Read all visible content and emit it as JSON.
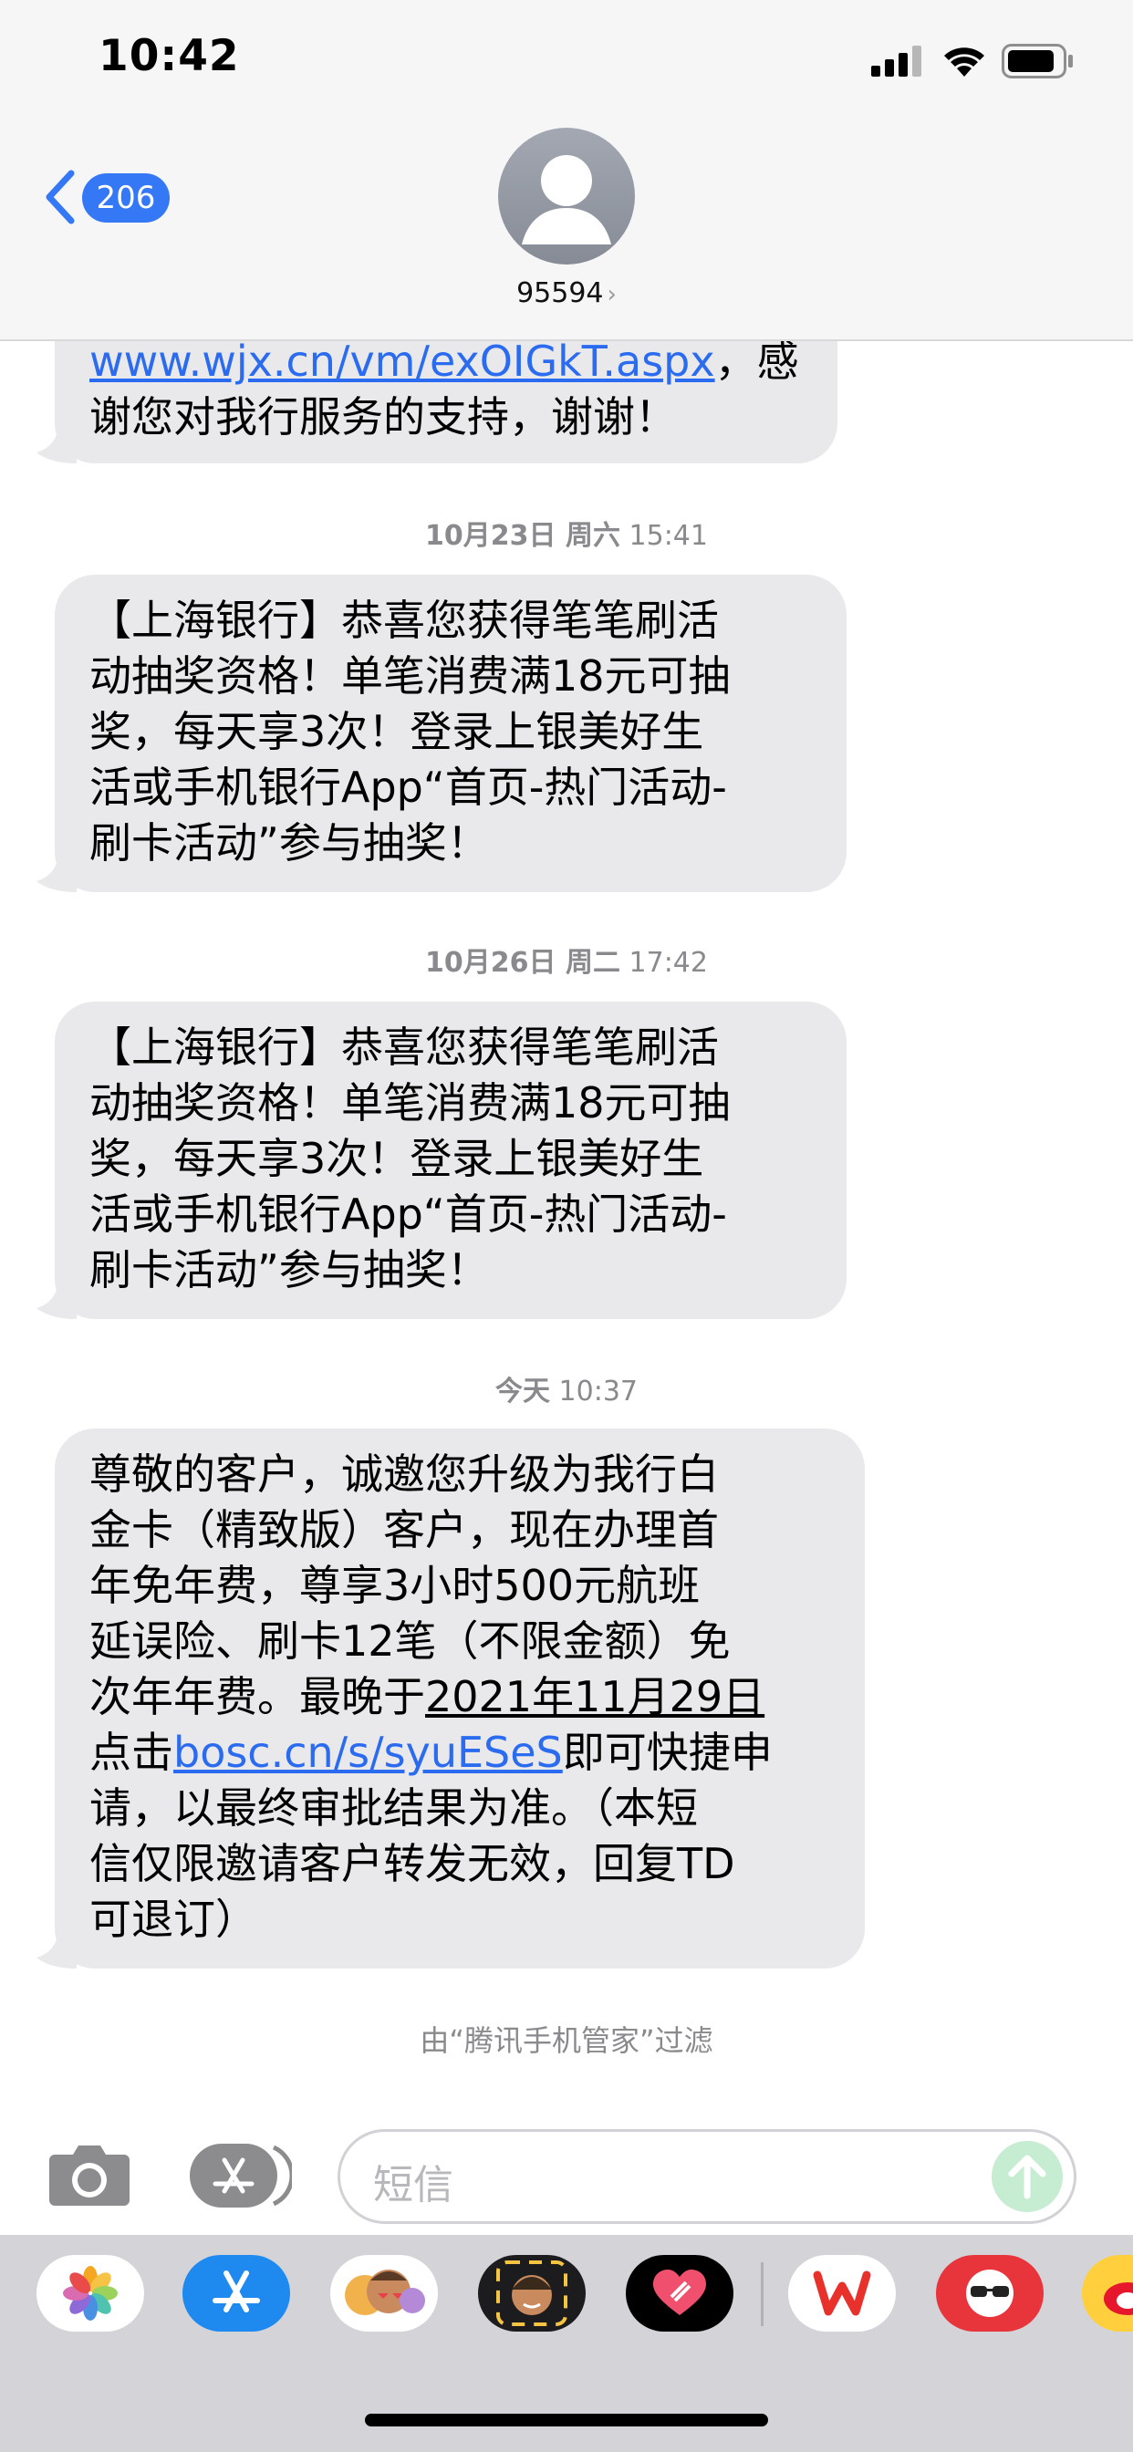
{
  "status_bar": {
    "time": "10:42"
  },
  "header": {
    "back_badge": "206",
    "contact_name": "95594",
    "contact_chevron": "›"
  },
  "messages": [
    {
      "id": "m0",
      "link": "www.wjx.cn/vm/exOIGkT.aspx",
      "lines": [
        "，感",
        "谢您对我行服务的支持，谢谢！"
      ]
    },
    {
      "id": "m1",
      "timestamp_date": "10月23日 周六",
      "timestamp_time": "15:41",
      "lines": [
        "【上海银行】恭喜您获得笔笔刷活",
        "动抽奖资格！单笔消费满18元可抽",
        "奖，每天享3次！登录上银美好生",
        "活或手机银行App“首页-热门活动-",
        "刷卡活动”参与抽奖！"
      ]
    },
    {
      "id": "m2",
      "timestamp_date": "10月26日 周二",
      "timestamp_time": "17:42",
      "lines": [
        "【上海银行】恭喜您获得笔笔刷活",
        "动抽奖资格！单笔消费满18元可抽",
        "奖，每天享3次！登录上银美好生",
        "活或手机银行App“首页-热门活动-",
        "刷卡活动”参与抽奖！"
      ]
    },
    {
      "id": "m3",
      "timestamp_date": "今天",
      "timestamp_time": "10:37",
      "lines": [
        "尊敬的客户，诚邀您升级为我行白",
        "金卡（精致版）客户，现在办理首",
        "年免年费，尊享3小时500元航班",
        "延误险、刷卡12笔（不限金额）免",
        "次年年费。最晚于"
      ],
      "date_text": "2021年11月29日",
      "line_before_link": "点击",
      "link": "bosc.cn/s/syuESeS",
      "line_after_link": "即可快捷申",
      "lines_after": [
        "请，以最终审批结果为准。（本短",
        "信仅限邀请客户转发无效，回复TD",
        "可退订）"
      ]
    }
  ],
  "filter_note": "由“腾讯手机管家”过滤",
  "input": {
    "placeholder": "短信"
  },
  "app_drawer": {
    "apps": [
      "photos-app",
      "app-store-app",
      "memoji-app",
      "memoji-stickers-app",
      "digital-touch-app",
      "wps-app",
      "sunglasses-app",
      "weibo-app"
    ]
  },
  "colors": {
    "accent": "#3478f6",
    "bubble": "#e9e9eb",
    "link": "#2a6bf0",
    "send": "#c6ecd2"
  }
}
